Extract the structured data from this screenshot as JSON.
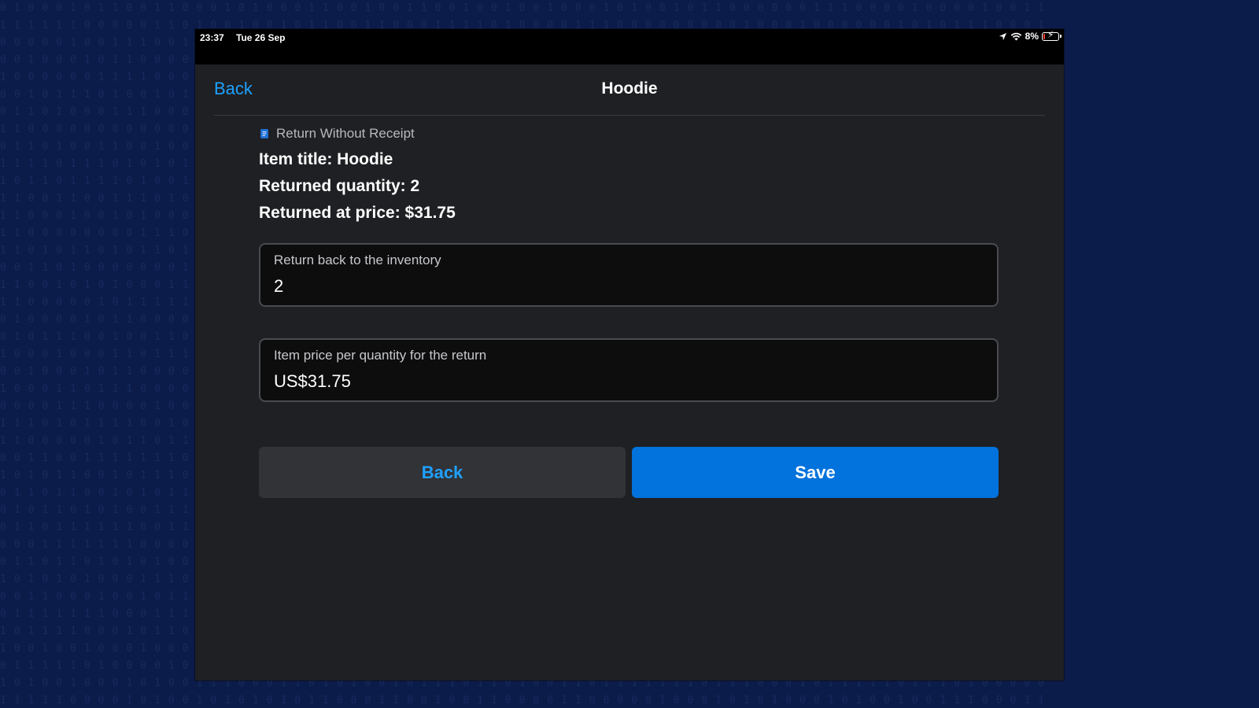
{
  "status_bar": {
    "time": "23:37",
    "date": "Tue 26 Sep",
    "battery_percent": "8%",
    "battery_level": 0.08,
    "icons": [
      "location-arrow-icon",
      "wifi-icon",
      "battery-charging-icon"
    ]
  },
  "nav": {
    "back_label": "Back",
    "title": "Hoodie"
  },
  "return_info": {
    "header": "Return Without Receipt",
    "header_icon": "receipt-icon",
    "item_title": "Item title: Hoodie",
    "returned_quantity": "Returned quantity: 2",
    "returned_price": "Returned at price: $31.75"
  },
  "fields": {
    "inventory": {
      "label": "Return back to the inventory",
      "value": "2"
    },
    "price": {
      "label": "Item price per quantity for the return",
      "value": "US$31.75"
    }
  },
  "actions": {
    "back_label": "Back",
    "save_label": "Save"
  },
  "colors": {
    "accent": "#1ea1ff",
    "primary_button": "#0272dc",
    "panel": "#1f2023",
    "background": "#0c1c4a"
  }
}
